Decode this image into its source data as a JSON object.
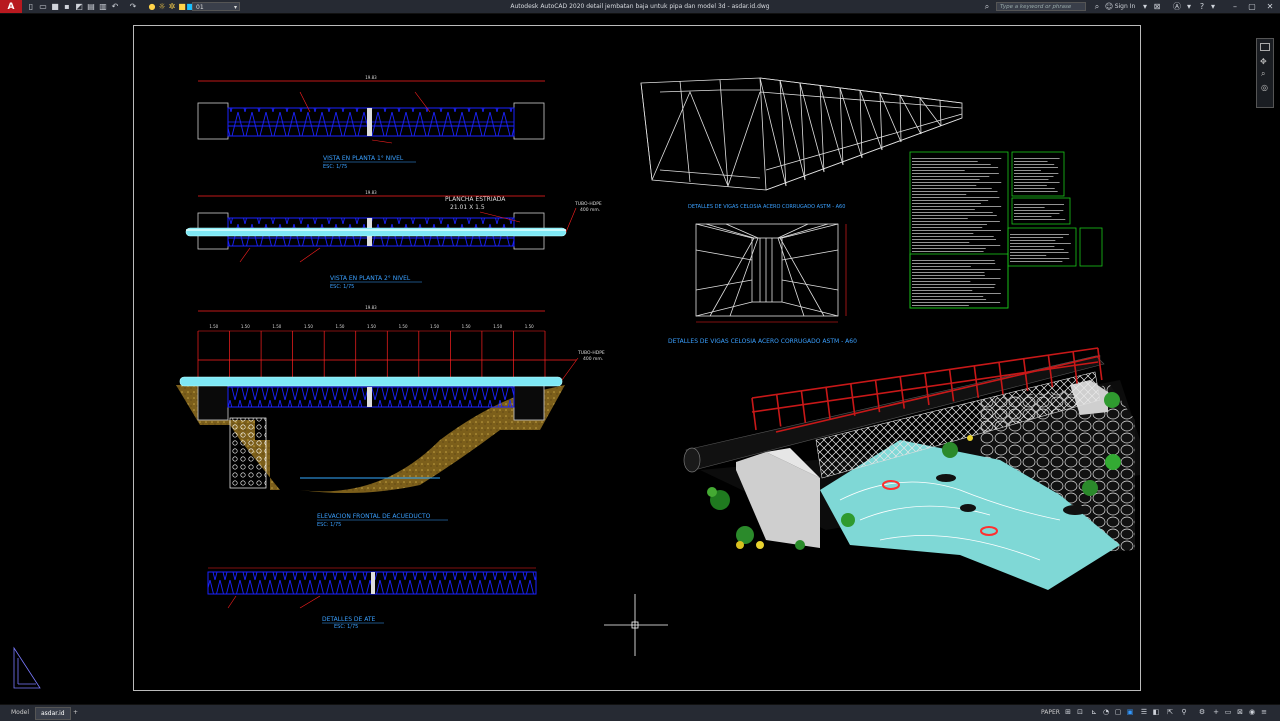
{
  "window": {
    "title": "Autodesk AutoCAD 2020    detail jembatan baja untuk pipa dan model 3d - asdar.id.dwg",
    "app_menu_letter": "A",
    "layer_value": "01",
    "search_placeholder": "Type a keyword or phrase",
    "signin_label": "Sign In"
  },
  "drawing": {
    "plan1_title": "VISTA EN PLANTA 1° NIVEL",
    "plan1_scale": "ESC: 1/75",
    "plan2_title": "VISTA EN PLANTA 2° NIVEL",
    "plan2_scale": "ESC: 1/75",
    "plancha_label": "PLANCHA ESTRIADA",
    "plancha_dims": "21.01 X 1.5",
    "tubo_label_1": "TUBO-HDPE",
    "tubo_size_1": "400 mm.",
    "tubo_label_2": "TUBO-HDPE",
    "tubo_size_2": "400 mm.",
    "elev_title": "ELEVACION FRONTAL DE ACUEDUCTO",
    "elev_scale": "ESC: 1/75",
    "detail_title": "DETALLES DE ATE",
    "detail_scale": "ESC: 1/75",
    "truss3d_title": "DETALLES DE VIGAS CELOSIA ACERO CORRUGADO ASTM - A60",
    "section_title": "DETALLES DE VIGAS CELOSIA ACERO CORRUGADO ASTM - A60",
    "dim_top_1": "19.83",
    "dim_top_2": "19.83",
    "dim_top_3": "19.83",
    "spacing_values": [
      "1.50",
      "1.50",
      "1.50",
      "1.50",
      "1.50",
      "1.50",
      "1.50",
      "1.50",
      "1.50",
      "1.50",
      "1.50"
    ]
  },
  "status": {
    "tab_model": "Model",
    "tab_layout": "asdar.id",
    "paper_label": "PAPER"
  },
  "colors": {
    "truss_blue": "#1a22ff",
    "pipe_cyan": "#7fe8f5",
    "dim_red": "#ff2020",
    "title_cyan": "#3aa0ff",
    "table_green": "#19c819",
    "rail_red": "#c81818",
    "water": "#7fd8d6"
  }
}
